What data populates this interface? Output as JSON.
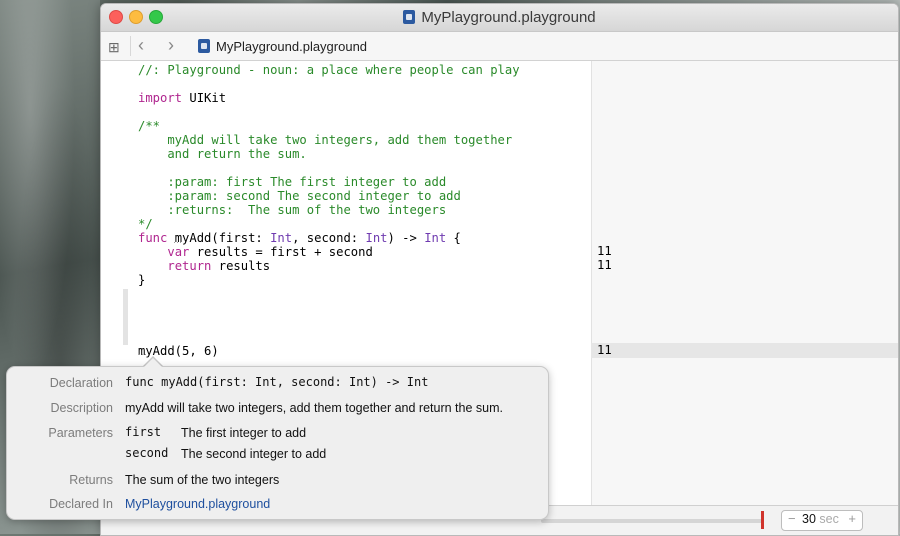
{
  "window": {
    "title": "MyPlayground.playground",
    "breadcrumb": "MyPlayground.playground"
  },
  "icons": [
    "grid-icon",
    "back-icon",
    "forward-icon",
    "playground-file-icon"
  ],
  "code": {
    "lines": {
      "l1": "//: Playground - noun: a place where people can play",
      "l2a": "import",
      "l2b": " UIKit",
      "l3": "/**",
      "l4": "    myAdd will take two integers, add them together",
      "l5": "    and return the sum.",
      "l6": "    :param: first The first integer to add",
      "l7": "    :param: second The second integer to add",
      "l8": "    :returns:  The sum of the two integers",
      "l9": "*/",
      "f1": "func",
      "f2": " myAdd(first: ",
      "f3": "Int",
      "f4": ", second: ",
      "f5": "Int",
      "f6": ") -> ",
      "f7": "Int",
      "f8": " {",
      "v1": "    ",
      "v2": "var",
      "v3": " results = first + second",
      "r1": "    ",
      "r2": "return",
      "r3": " results",
      "close": "}",
      "call": "myAdd(5, 6)"
    }
  },
  "results": {
    "var_line": "11",
    "return_line": "11",
    "call_line": "11"
  },
  "popover": {
    "declaration_label": "Declaration",
    "declaration_value": "func myAdd(first: Int, second: Int) -> Int",
    "description_label": "Description",
    "description_value": "myAdd will take two integers, add them together and return the sum.",
    "parameters_label": "Parameters",
    "param1_name": "first",
    "param1_desc": "The first integer to add",
    "param2_name": "second",
    "param2_desc": "The second integer to add",
    "returns_label": "Returns",
    "returns_value": "The sum of the two integers",
    "declared_in_label": "Declared In",
    "declared_in_value": "MyPlayground.playground"
  },
  "timeline": {
    "duration_value": "30",
    "duration_unit": "sec",
    "minus": "−",
    "plus": "+"
  },
  "colors": {
    "comment": "#2a8a2a",
    "keyword": "#b0268f",
    "type": "#6f3bb0",
    "link": "#1e4f9e",
    "timeline_marker": "#d0342c"
  }
}
